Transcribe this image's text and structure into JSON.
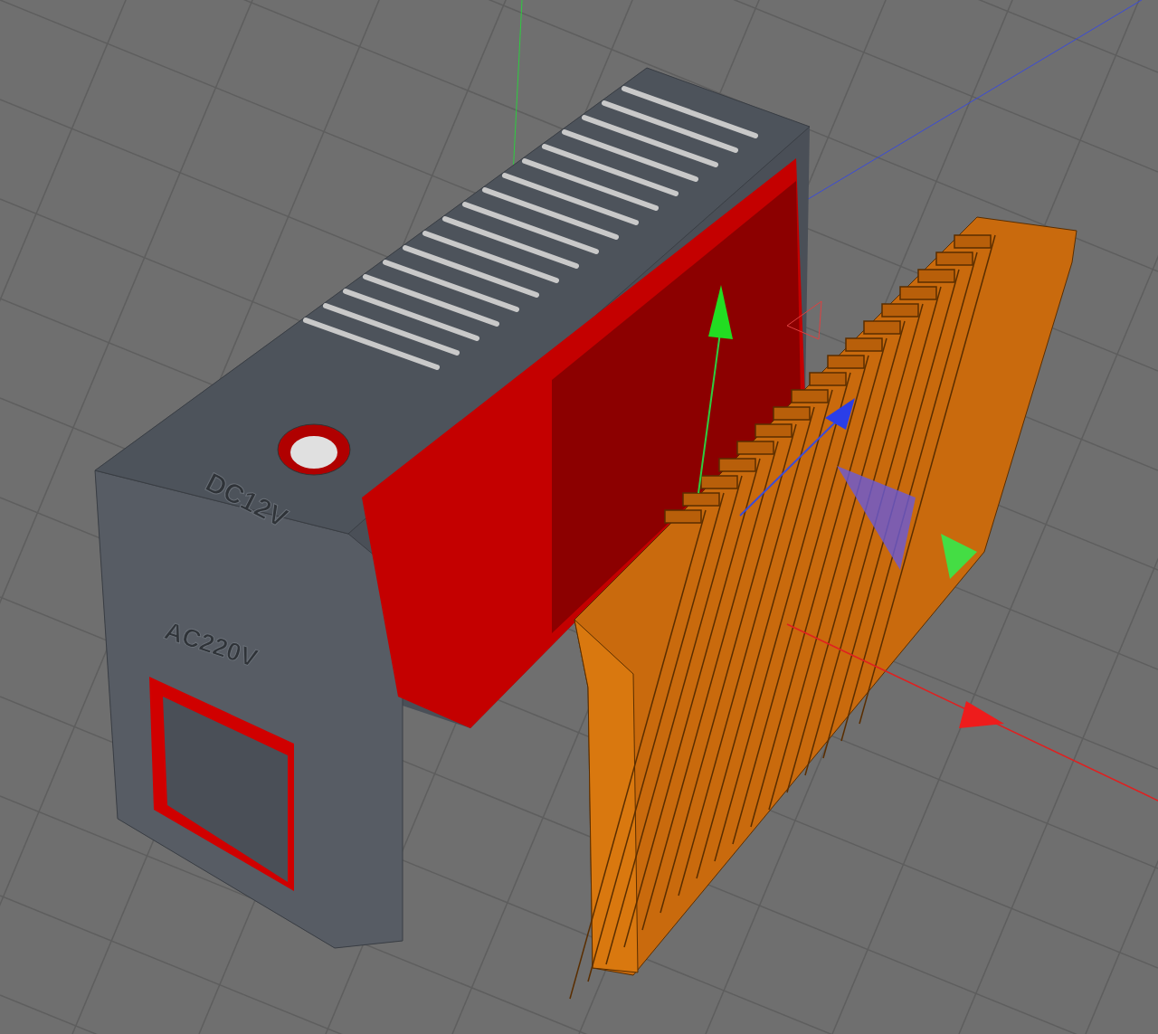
{
  "viewport": {
    "model_labels": [
      {
        "text": "DC12V",
        "kind": "engraved"
      },
      {
        "text": "AC220V",
        "kind": "engraved"
      }
    ]
  }
}
